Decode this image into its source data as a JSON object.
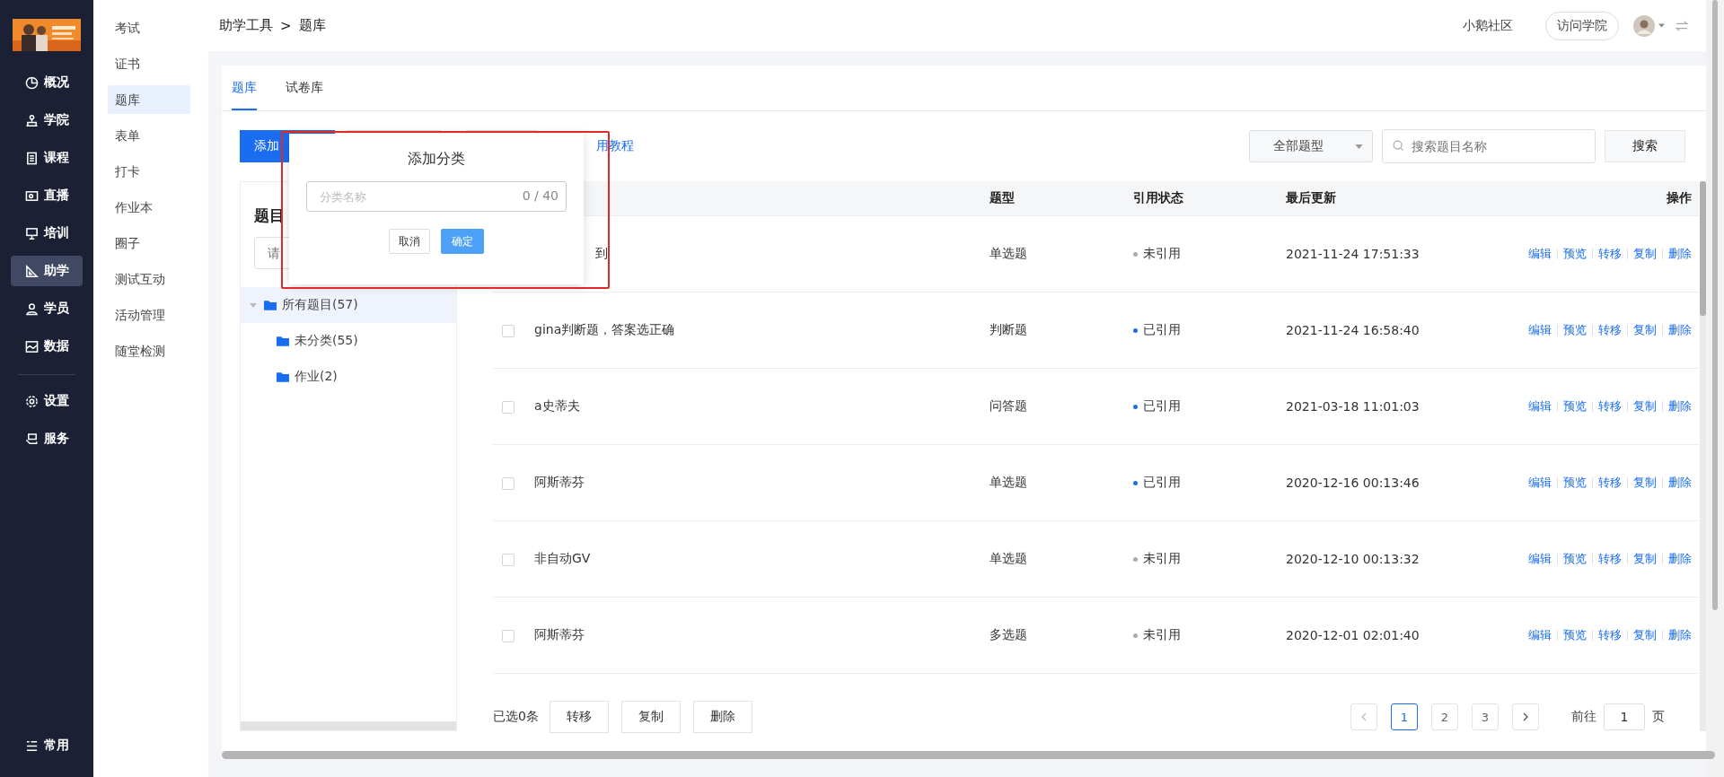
{
  "nav": [
    {
      "label": "概况",
      "selected": false
    },
    {
      "label": "学院",
      "selected": false
    },
    {
      "label": "课程",
      "selected": false
    },
    {
      "label": "直播",
      "selected": false
    },
    {
      "label": "培训",
      "selected": false
    },
    {
      "label": "助学",
      "selected": true
    },
    {
      "label": "学员",
      "selected": false
    },
    {
      "label": "数据",
      "selected": false
    }
  ],
  "nav_bottom": [
    {
      "label": "设置",
      "selected": false
    },
    {
      "label": "服务",
      "selected": false
    }
  ],
  "nav_footer": {
    "label": "常用"
  },
  "subnav": [
    {
      "label": "考试",
      "selected": false
    },
    {
      "label": "证书",
      "selected": false
    },
    {
      "label": "题库",
      "selected": true
    },
    {
      "label": "表单",
      "selected": false
    },
    {
      "label": "打卡",
      "selected": false
    },
    {
      "label": "作业本",
      "selected": false
    },
    {
      "label": "圈子",
      "selected": false
    },
    {
      "label": "测试互动",
      "selected": false
    },
    {
      "label": "活动管理",
      "selected": false
    },
    {
      "label": "随堂检测",
      "selected": false
    }
  ],
  "breadcrumb": [
    "助学工具",
    ">",
    "题库"
  ],
  "header": {
    "community": "小鹅社区",
    "visit": "访问学院"
  },
  "tabs": [
    {
      "label": "题库",
      "selected": true
    },
    {
      "label": "试卷库",
      "selected": false
    }
  ],
  "toolbar": {
    "add": "添加",
    "tutorial": "用教程",
    "type_select": "全部题型",
    "search_placeholder": "搜索题目名称",
    "search": "搜索"
  },
  "tree": {
    "title": "题目",
    "search_placeholder": "请",
    "items": [
      {
        "label": "所有题目(57)",
        "selected": true,
        "expanded": true,
        "children": [
          {
            "label": "未分类(55)"
          },
          {
            "label": "作业(2)"
          }
        ]
      }
    ]
  },
  "table": {
    "columns": [
      "题型",
      "引用状态",
      "最后更新",
      "操作"
    ],
    "rows": [
      {
        "title": "到",
        "type": "单选题",
        "referenced": false,
        "status": "未引用",
        "updated": "2021-11-24 17:51:33",
        "actions": [
          "编辑",
          "预览",
          "转移",
          "复制",
          "删除"
        ]
      },
      {
        "checked": false,
        "title": "gina判断题，答案选正确",
        "type": "判断题",
        "referenced": true,
        "status": "已引用",
        "updated": "2021-11-24 16:58:40",
        "actions": [
          "编辑",
          "预览",
          "转移",
          "复制",
          "删除"
        ]
      },
      {
        "checked": false,
        "title": "a史蒂夫",
        "type": "问答题",
        "referenced": true,
        "status": "已引用",
        "updated": "2021-03-18 11:01:03",
        "actions": [
          "编辑",
          "预览",
          "转移",
          "复制",
          "删除"
        ]
      },
      {
        "checked": false,
        "title": "阿斯蒂芬",
        "type": "单选题",
        "referenced": true,
        "status": "已引用",
        "updated": "2020-12-16 00:13:46",
        "actions": [
          "编辑",
          "预览",
          "转移",
          "复制",
          "删除"
        ]
      },
      {
        "checked": false,
        "title": "非自动GV",
        "type": "单选题",
        "referenced": false,
        "status": "未引用",
        "updated": "2020-12-10 00:13:32",
        "actions": [
          "编辑",
          "预览",
          "转移",
          "复制",
          "删除"
        ]
      },
      {
        "checked": false,
        "title": "阿斯蒂芬",
        "type": "多选题",
        "referenced": false,
        "status": "未引用",
        "updated": "2020-12-01 02:01:40",
        "actions": [
          "编辑",
          "预览",
          "转移",
          "复制",
          "删除"
        ]
      }
    ]
  },
  "footer": {
    "selected_count": "已选0条",
    "buttons": [
      "转移",
      "复制",
      "删除"
    ],
    "pages": [
      {
        "label": "1",
        "selected": true
      },
      {
        "label": "2",
        "selected": false
      },
      {
        "label": "3",
        "selected": false
      }
    ],
    "goto_label": "前往",
    "goto_value": "1",
    "page_unit": "页"
  },
  "dialog": {
    "title": "添加分类",
    "placeholder": "分类名称",
    "counter": "0 / 40",
    "cancel": "取消",
    "confirm": "确定"
  }
}
